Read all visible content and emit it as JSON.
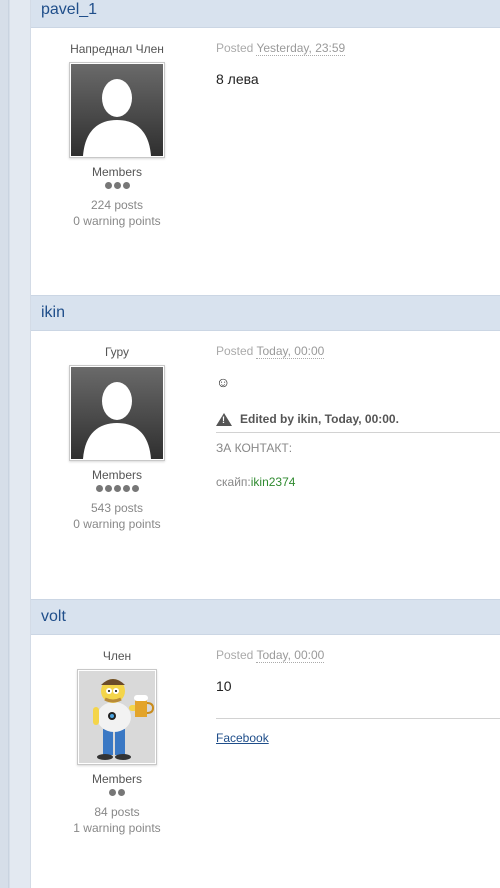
{
  "posts": [
    {
      "author": "pavel_1",
      "rank": "Напреднал Член",
      "group": "Members",
      "pips": 3,
      "posts": "224 posts",
      "warnings": "0 warning points",
      "posted_label": "Posted",
      "posted_time": "Yesterday, 23:59",
      "body": "8 лева",
      "avatar": "default-avatar"
    },
    {
      "author": "ikin",
      "rank": "Гуру",
      "group": "Members",
      "pips": 5,
      "posts": "543 posts",
      "warnings": "0 warning points",
      "posted_label": "Posted",
      "posted_time": "Today, 00:00",
      "body": "☺",
      "edit_note": "Edited by ikin, Today, 00:00.",
      "signature_line1": "ЗА КОНТАКТ:",
      "signature_prefix": "скайп:",
      "signature_value": "ikin2374",
      "avatar": "default-avatar"
    },
    {
      "author": "volt",
      "rank": "Член",
      "group": "Members",
      "pips": 2,
      "posts": "84 posts",
      "warnings": "1 warning points",
      "posted_label": "Posted",
      "posted_time": "Today, 00:00",
      "body": "10",
      "signature_link": "Facebook",
      "avatar": "cartoon-avatar"
    }
  ],
  "colors": {
    "accent": "#1f4e8a",
    "header_bg": "#d8e2ee",
    "green": "#2f8a2f"
  }
}
